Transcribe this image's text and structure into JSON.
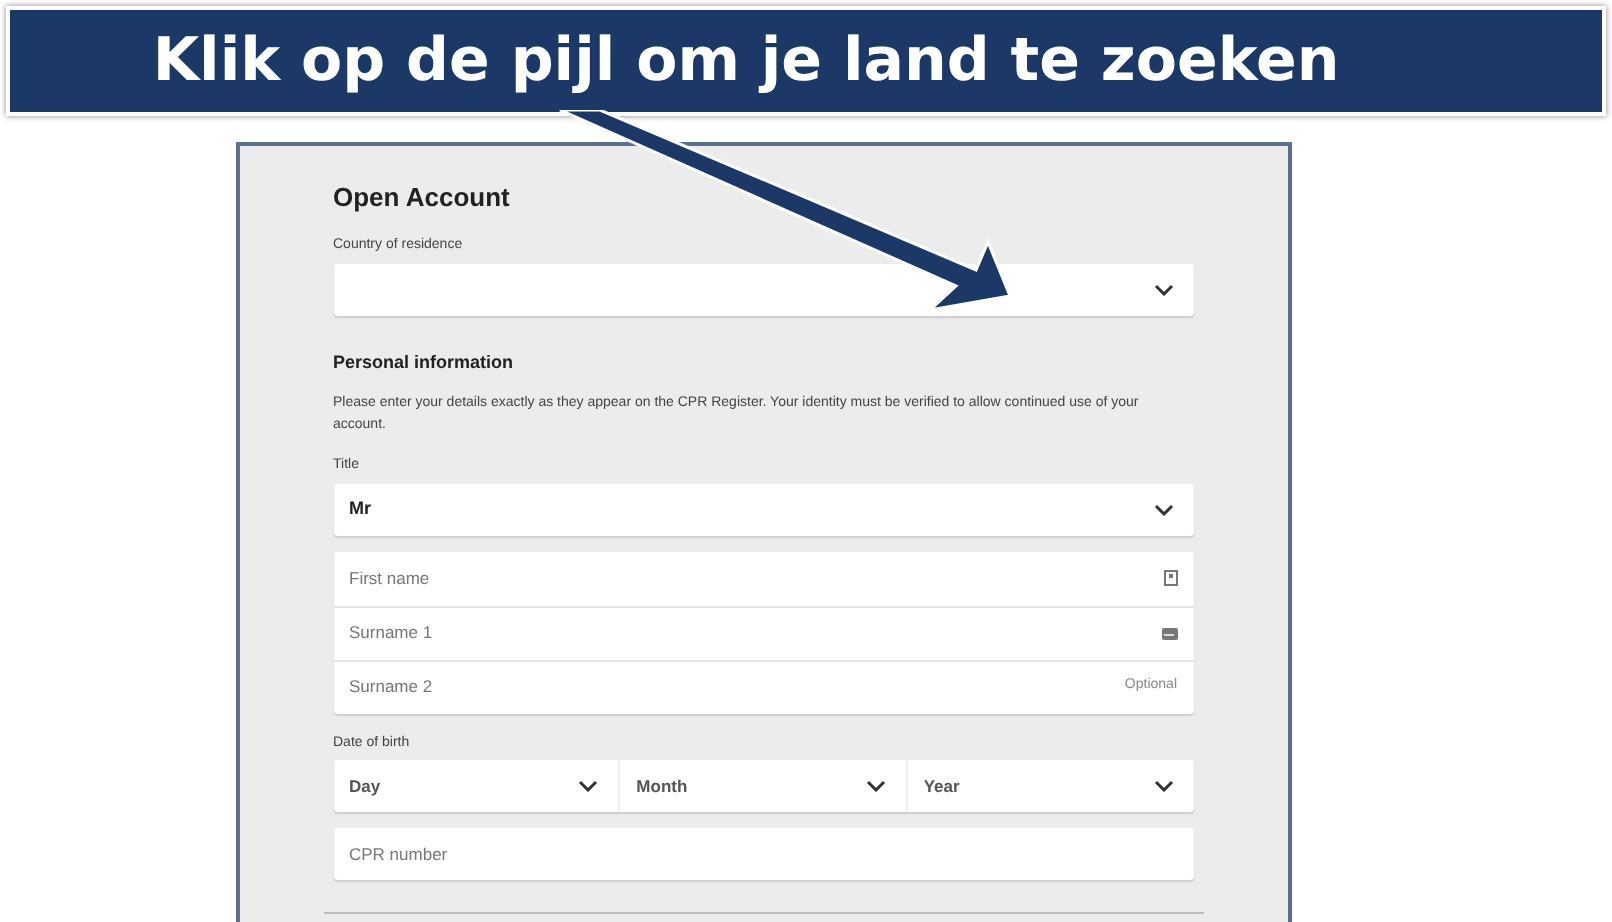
{
  "banner": {
    "text": "Klik op de pijl om je land te zoeken"
  },
  "form": {
    "title": "Open Account",
    "country": {
      "label": "Country of residence"
    },
    "section_title": "Personal information",
    "description": "Please enter your details exactly as they appear on the CPR Register. Your identity must be verified to allow continued use of your account.",
    "title_field": {
      "label": "Title",
      "value": "Mr"
    },
    "name_fields": [
      {
        "placeholder": "First name",
        "kind": "card-icon"
      },
      {
        "placeholder": "Surname 1",
        "kind": "id-icon"
      },
      {
        "placeholder": "Surname 2",
        "kind": "hint",
        "hint": "Optional"
      }
    ],
    "dob": {
      "label": "Date of birth",
      "selects": [
        "Day",
        "Month",
        "Year"
      ]
    },
    "cpr": {
      "placeholder": "CPR number"
    }
  }
}
